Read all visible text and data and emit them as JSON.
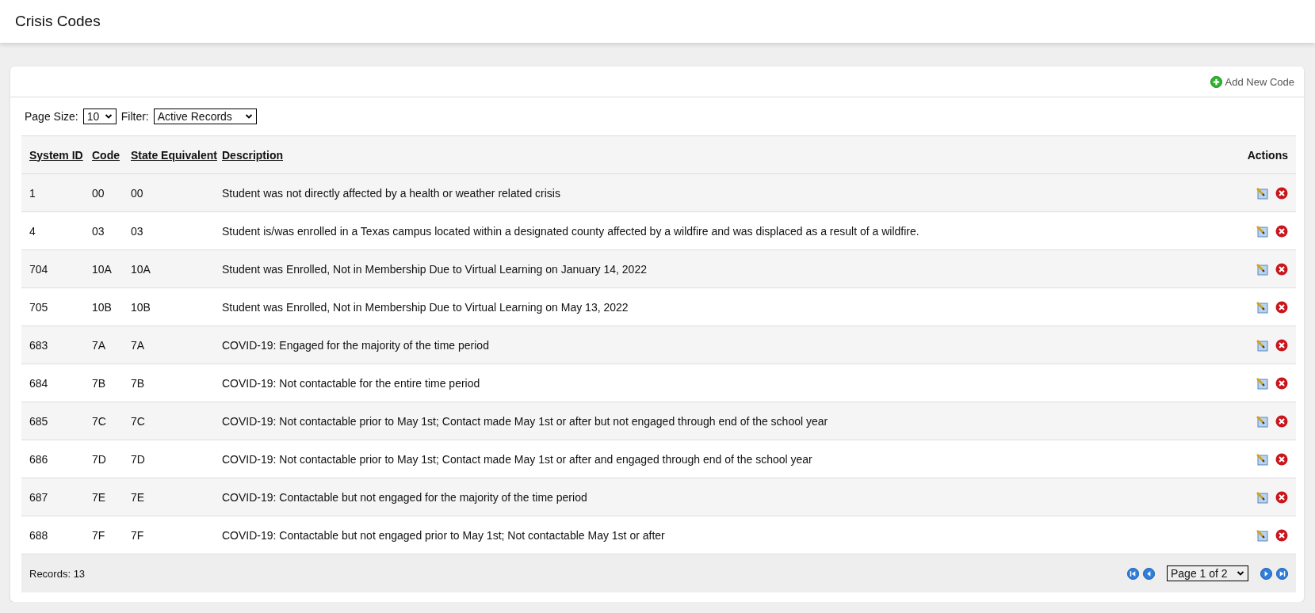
{
  "page": {
    "title": "Crisis Codes"
  },
  "toolbar": {
    "add_label": "Add New Code"
  },
  "filters": {
    "page_size_label": "Page Size:",
    "page_size": "10",
    "filter_label": "Filter:",
    "filter": "Active Records"
  },
  "table": {
    "columns": [
      "System ID",
      "Code",
      "State Equivalent",
      "Description",
      "Actions"
    ],
    "rows": [
      {
        "id": "1",
        "code": "00",
        "state": "00",
        "description": "Student was not directly affected by a health or weather related crisis"
      },
      {
        "id": "4",
        "code": "03",
        "state": "03",
        "description": "Student is/was enrolled in a Texas campus located within a designated county affected by a wildfire and was displaced as a result of a wildfire."
      },
      {
        "id": "704",
        "code": "10A",
        "state": "10A",
        "description": "Student was Enrolled, Not in Membership Due to Virtual Learning on January 14, 2022"
      },
      {
        "id": "705",
        "code": "10B",
        "state": "10B",
        "description": "Student was Enrolled, Not in Membership Due to Virtual Learning on May 13, 2022"
      },
      {
        "id": "683",
        "code": "7A",
        "state": "7A",
        "description": "COVID-19: Engaged for the majority of the time period"
      },
      {
        "id": "684",
        "code": "7B",
        "state": "7B",
        "description": "COVID-19: Not contactable for the entire time period"
      },
      {
        "id": "685",
        "code": "7C",
        "state": "7C",
        "description": "COVID-19: Not contactable prior to May 1st; Contact made May 1st or after but not engaged through end of the school year"
      },
      {
        "id": "686",
        "code": "7D",
        "state": "7D",
        "description": "COVID-19: Not contactable prior to May 1st; Contact made May 1st or after and engaged through end of the school year"
      },
      {
        "id": "687",
        "code": "7E",
        "state": "7E",
        "description": "COVID-19: Contactable but not engaged for the majority of the time period"
      },
      {
        "id": "688",
        "code": "7F",
        "state": "7F",
        "description": "COVID-19: Contactable but not engaged prior to May 1st; Not contactable May 1st or after"
      }
    ]
  },
  "footer": {
    "records": "Records: 13",
    "page": "Page 1 of 2"
  }
}
